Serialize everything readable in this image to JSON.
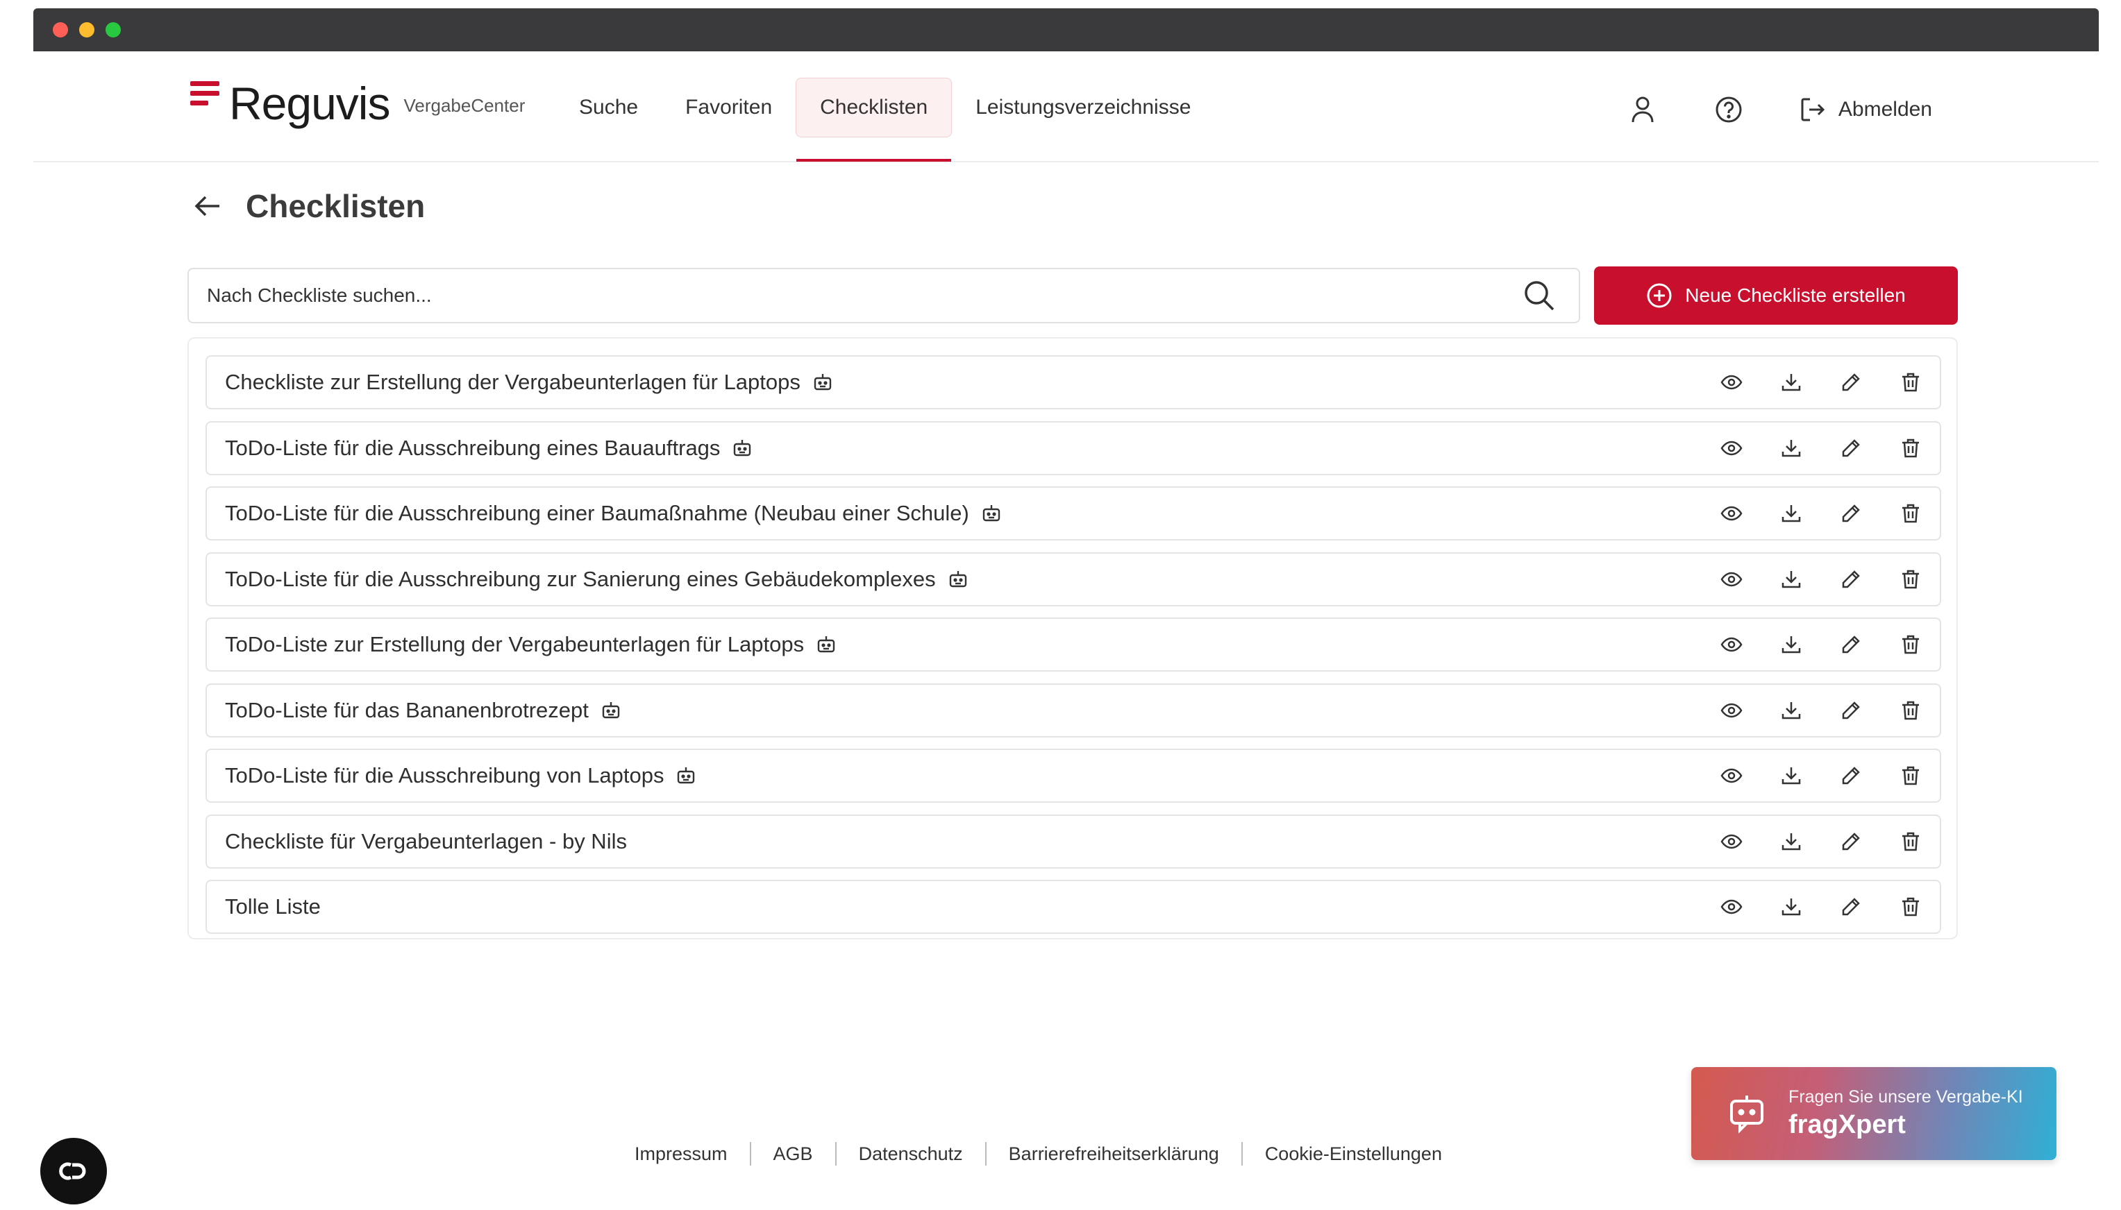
{
  "brand": {
    "name": "Reguvis",
    "subtitle": "VergabeCenter",
    "accent": "#c8102e"
  },
  "nav": {
    "items": [
      {
        "label": "Suche",
        "active": false
      },
      {
        "label": "Favoriten",
        "active": false
      },
      {
        "label": "Checklisten",
        "active": true
      },
      {
        "label": "Leistungsverzeichnisse",
        "active": false
      }
    ],
    "profile_icon": "user-icon",
    "help_icon": "help-circle-icon",
    "logout_label": "Abmelden"
  },
  "page": {
    "title": "Checklisten"
  },
  "search": {
    "placeholder": "Nach Checkliste suchen...",
    "value": ""
  },
  "new_button": {
    "label": "Neue Checkliste erstellen"
  },
  "checklists": [
    {
      "label": "Checkliste zur Erstellung der Vergabeunterlagen für Laptops",
      "ai": true
    },
    {
      "label": "ToDo-Liste für die Ausschreibung eines Bauauftrags",
      "ai": true
    },
    {
      "label": "ToDo-Liste für die Ausschreibung einer Baumaßnahme (Neubau einer Schule)",
      "ai": true
    },
    {
      "label": "ToDo-Liste für die Ausschreibung zur Sanierung eines Gebäudekomplexes",
      "ai": true
    },
    {
      "label": "ToDo-Liste zur Erstellung der Vergabeunterlagen für Laptops",
      "ai": true
    },
    {
      "label": "ToDo-Liste für das Bananenbrotrezept",
      "ai": true
    },
    {
      "label": "ToDo-Liste für die Ausschreibung von Laptops",
      "ai": true
    },
    {
      "label": "Checkliste für Vergabeunterlagen - by Nils",
      "ai": false
    },
    {
      "label": "Tolle Liste",
      "ai": false
    }
  ],
  "row_actions": [
    "eye-icon",
    "download-icon",
    "pencil-icon",
    "trash-icon"
  ],
  "footer": {
    "links": [
      "Impressum",
      "AGB",
      "Datenschutz",
      "Barrierefreiheitserklärung",
      "Cookie-Einstellungen"
    ]
  },
  "ai_assistant": {
    "subtitle": "Fragen Sie unsere Vergabe-KI",
    "title": "fragXpert"
  }
}
